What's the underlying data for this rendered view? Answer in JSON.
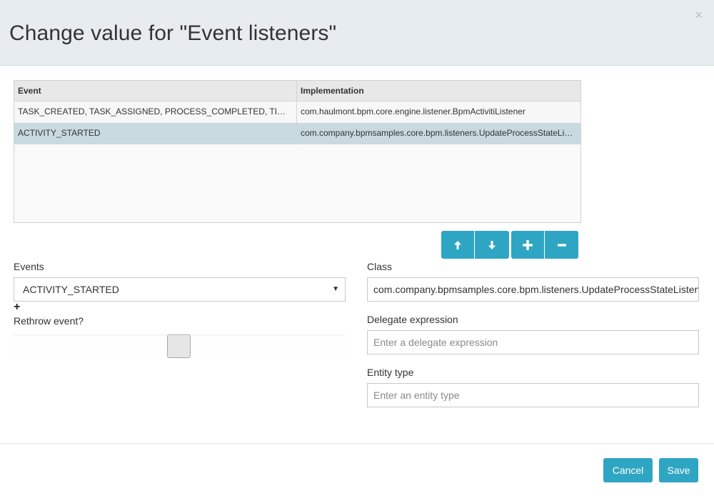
{
  "dialog": {
    "title": "Change value for \"Event listeners\"",
    "close_glyph": "×"
  },
  "grid": {
    "columns": [
      "Event",
      "Implementation"
    ],
    "rows": [
      {
        "event": "TASK_CREATED, TASK_ASSIGNED, PROCESS_COMPLETED, TIMER_FI...",
        "implementation": "com.haulmont.bpm.core.engine.listener.BpmActivitiListener",
        "selected": false
      },
      {
        "event": "ACTIVITY_STARTED",
        "implementation": "com.company.bpmsamples.core.bpm.listeners.UpdateProcessStateListe...",
        "selected": true
      }
    ]
  },
  "toolbar": {
    "move_up_icon": "arrow-up-icon",
    "move_down_icon": "arrow-down-icon",
    "add_icon": "plus-icon",
    "remove_icon": "minus-icon"
  },
  "form": {
    "events_label": "Events",
    "events_value": "ACTIVITY_STARTED",
    "events_add_glyph": "+",
    "rethrow_label": "Rethrow event?",
    "class_label": "Class",
    "class_value": "com.company.bpmsamples.core.bpm.listeners.UpdateProcessStateListener",
    "delegate_label": "Delegate expression",
    "delegate_placeholder": "Enter a delegate expression",
    "entity_label": "Entity type",
    "entity_placeholder": "Enter an entity type"
  },
  "footer": {
    "cancel_label": "Cancel",
    "save_label": "Save"
  },
  "colors": {
    "accent": "#2fa5c4",
    "header_bg": "#e7ecf0",
    "selected_row": "#c8dae0"
  }
}
